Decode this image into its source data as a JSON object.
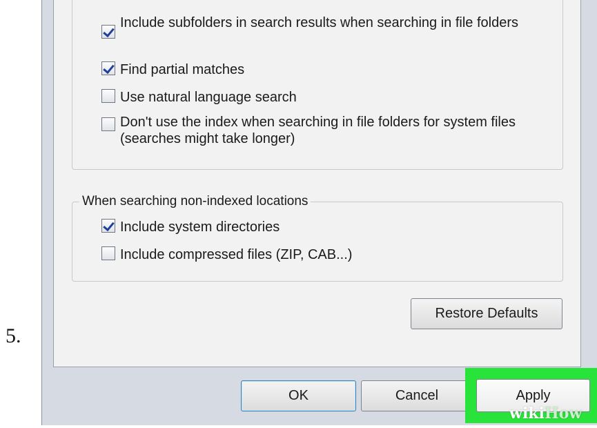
{
  "step_number": "5.",
  "indexed_options": [
    {
      "label": "Include subfolders in search results when searching in file folders",
      "checked": true
    },
    {
      "label": "Find partial matches",
      "checked": true
    },
    {
      "label": "Use natural language search",
      "checked": false
    },
    {
      "label": "Don't use the index when searching in file folders for system files (searches might take longer)",
      "checked": false
    }
  ],
  "non_indexed_group": {
    "title": "When searching non-indexed locations",
    "options": [
      {
        "label": "Include system directories",
        "checked": true
      },
      {
        "label": "Include compressed files (ZIP, CAB...)",
        "checked": false
      }
    ]
  },
  "buttons": {
    "restore_defaults": "Restore Defaults",
    "ok": "OK",
    "cancel": "Cancel",
    "apply": "Apply"
  },
  "highlight_color": "#27e33a",
  "watermark": {
    "wiki": "wiki",
    "how": "How"
  }
}
